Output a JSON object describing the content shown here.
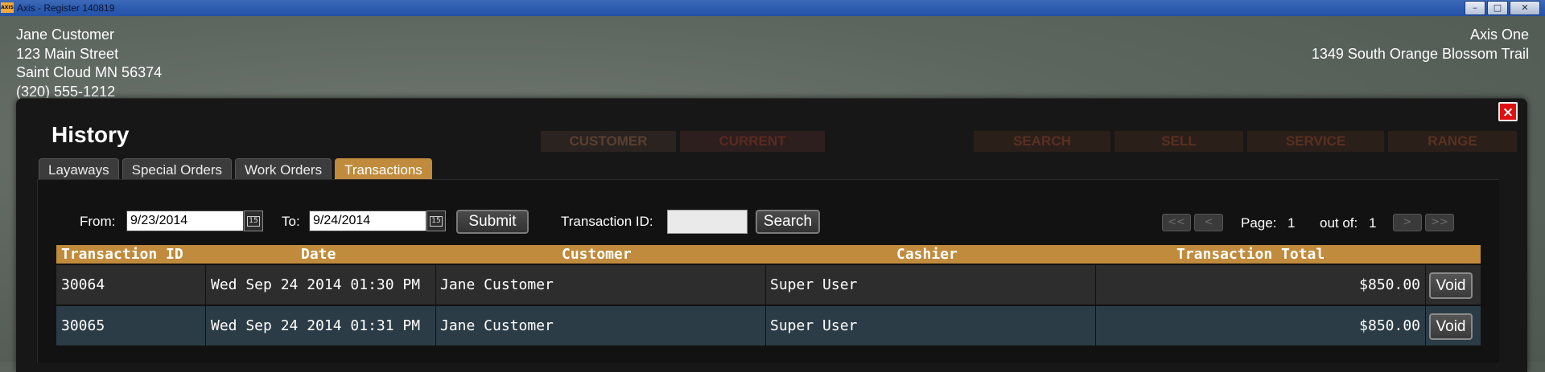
{
  "window": {
    "app_icon": "AXIS",
    "title": "Axis - Register  140819",
    "minimize_icon": "minimize-icon",
    "maximize_icon": "maximize-icon",
    "close_icon": "close-icon"
  },
  "customer": {
    "name": "Jane Customer",
    "street": "123 Main Street",
    "city": "Saint Cloud MN 56374",
    "phone": "(320) 555-1212"
  },
  "store": {
    "name": "Axis One",
    "address": "1349 South Orange Blossom Trail"
  },
  "background_tabs": [
    "CUSTOMER",
    "CURRENT",
    "SEARCH",
    "SELL",
    "SERVICE",
    "RANGE"
  ],
  "modal": {
    "title": "History",
    "close_label": "×",
    "tabs": [
      {
        "label": "Layaways",
        "active": false
      },
      {
        "label": "Special Orders",
        "active": false
      },
      {
        "label": "Work Orders",
        "active": false
      },
      {
        "label": "Transactions",
        "active": true
      }
    ],
    "filters": {
      "from_label": "From:",
      "from_value": "9/23/2014",
      "to_label": "To:",
      "to_value": "9/24/2014",
      "calendar_icon_text": "15",
      "submit_label": "Submit",
      "transaction_id_label": "Transaction ID:",
      "transaction_id_value": "",
      "search_label": "Search"
    },
    "pagination": {
      "first": "<<",
      "prev": "<",
      "page_label": "Page:",
      "page": "1",
      "out_of_label": "out of:",
      "total": "1",
      "next": ">",
      "last": ">>"
    },
    "table": {
      "columns": [
        "Transaction ID",
        "Date",
        "Customer",
        "Cashier",
        "Transaction Total"
      ],
      "rows": [
        {
          "id": "30064",
          "date": "Wed Sep 24 2014 01:30 PM",
          "customer": "Jane Customer",
          "cashier": "Super User",
          "total": "$850.00",
          "action": "Void"
        },
        {
          "id": "30065",
          "date": "Wed Sep 24 2014 01:31 PM",
          "customer": "Jane Customer",
          "cashier": "Super User",
          "total": "$850.00",
          "action": "Void"
        }
      ]
    }
  },
  "colors": {
    "accent": "#c08b3c",
    "modal_bg": "#171717",
    "row_alt": "#2b3c46",
    "close_red": "#e01010"
  }
}
